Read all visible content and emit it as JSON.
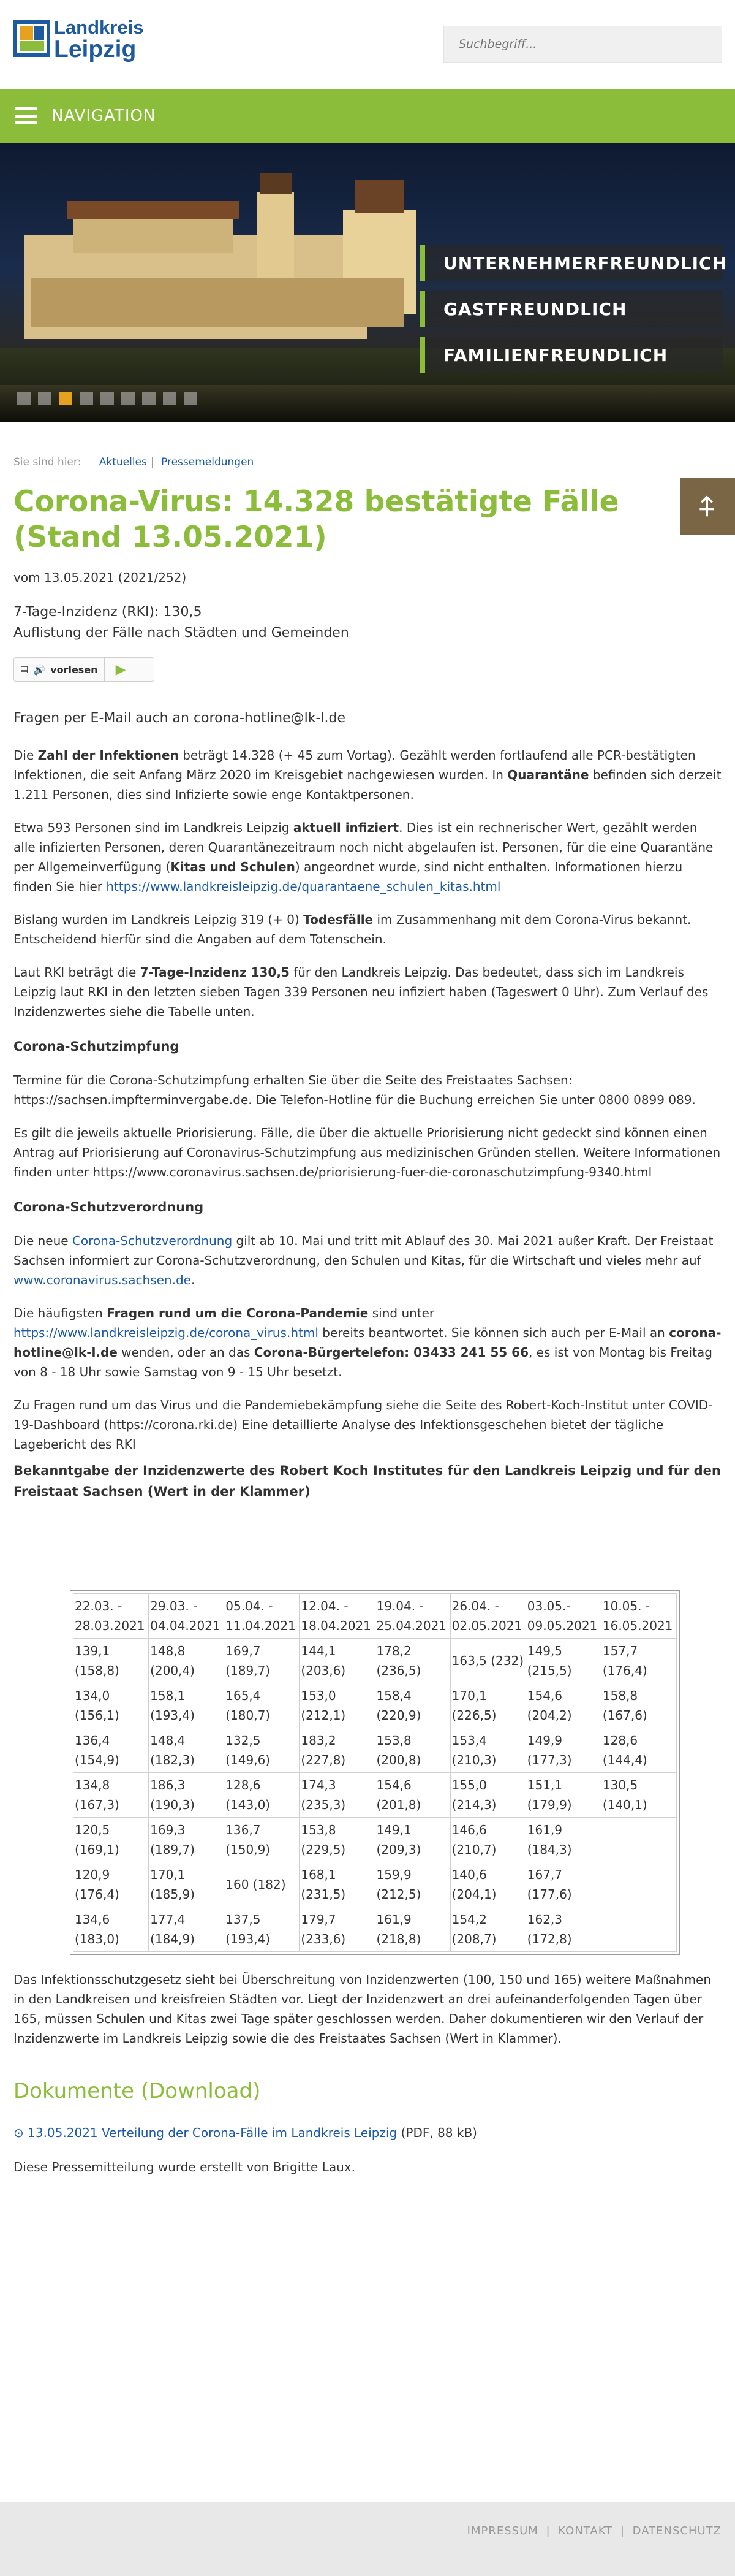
{
  "header": {
    "logo_line1": "Landkreis",
    "logo_line2": "Leipzig",
    "search_placeholder": "Suchbegriff...",
    "brand_colors": {
      "green": "#8bbd3b",
      "blue": "#1e5aa0",
      "orange": "#e6a21f"
    }
  },
  "nav": {
    "label": "NAVIGATION",
    "icon": "menu-icon"
  },
  "hero": {
    "claims": [
      "UNTERNEHMERFREUNDLICH",
      "GASTFREUNDLICH",
      "FAMILIENFREUNDLICH"
    ],
    "slide_count": 9,
    "active_slide": 2
  },
  "breadcrumb": {
    "label": "Sie sind hier:",
    "items": [
      "Aktuelles",
      "Pressemeldungen"
    ]
  },
  "article": {
    "title": "Corona-Virus: 14.328 bestätigte Fälle (Stand 13.05.2021)",
    "date": "vom 13.05.2021 (2021/252)",
    "incidence_line": "7-Tage-Inzidenz (RKI): 130,5",
    "subtitle": "Auflistung der Fälle nach Städten und Gemeinden",
    "reader_label": "vorlesen",
    "email_line": "Fragen per E-Mail auch an corona-hotline@lk-l.de",
    "p1_a": "Die ",
    "p1_b": "Zahl der Infektionen",
    "p1_c": " beträgt 14.328 (+ 45 zum Vortag). Gezählt werden fortlaufend alle PCR-bestätigten Infektionen, die seit Anfang März 2020 im Kreisgebiet nachgewiesen wurden. In ",
    "p1_d": "Quarantäne",
    "p1_e": " befinden sich derzeit 1.211 Personen, dies sind Infizierte sowie enge Kontaktpersonen.",
    "p2_a": "Etwa 593 Personen sind im Landkreis Leipzig ",
    "p2_b": "aktuell infiziert",
    "p2_c": ". Dies ist ein rechnerischer Wert, gezählt werden alle infizierten Personen, deren Quarantänezeitraum noch nicht abgelaufen ist. Personen, für die eine Quarantäne per Allgemeinverfügung (",
    "p2_d": "Kitas und Schulen",
    "p2_e": ") angeordnet wurde, sind nicht enthalten. Informationen hierzu finden Sie hier ",
    "p2_link": "https://www.landkreisleipzig.de/quarantaene_schulen_kitas.html",
    "p3_a": "Bislang wurden im Landkreis Leipzig 319 (+ 0) ",
    "p3_b": "Todesfälle",
    "p3_c": " im Zusammenhang mit dem Corona-Virus bekannt. Entscheidend hierfür sind die Angaben auf dem Totenschein.",
    "p4_a": "Laut RKI beträgt die ",
    "p4_b": "7-Tage-Inzidenz 130,5",
    "p4_c": " für den Landkreis Leipzig. Das bedeutet, dass sich im Landkreis Leipzig laut RKI in den letzten sieben Tagen 339 Personen neu infiziert haben (Tageswert 0 Uhr). Zum Verlauf des Inzidenzwertes siehe die Tabelle unten.",
    "h_impfung": "Corona-Schutzimpfung",
    "p5": "Termine für die Corona-Schutzimpfung erhalten Sie über die Seite des Freistaates Sachsen: https://sachsen.impfterminvergabe.de. Die Telefon-Hotline für die Buchung erreichen Sie unter 0800 0899 089.",
    "p6": "Es gilt die jeweils aktuelle Priorisierung. Fälle, die über die aktuelle Priorisierung nicht gedeckt sind können einen Antrag auf Priorisierung auf Coronavirus-Schutzimpfung aus medizinischen Gründen stellen. Weitere Informationen finden unter https://www.coronavirus.sachsen.de/priorisierung-fuer-die-coronaschutzimpfung-9340.html",
    "h_verordnung": "Corona-Schutzverordnung",
    "p7_a": "Die neue ",
    "p7_link": "Corona-Schutzverordnung",
    "p7_b": " gilt ab 10. Mai und tritt mit Ablauf des 30. Mai 2021 außer Kraft. Der Freistaat Sachsen informiert zur Corona-Schutzverordnung, den Schulen und Kitas, für die Wirtschaft und vieles mehr auf ",
    "p7_link2": "www.coronavirus.sachsen.de",
    "p7_c": ".",
    "p8_a": "Die häufigsten ",
    "p8_b": "Fragen rund um die Corona-Pandemie",
    "p8_c": " sind unter ",
    "p8_link": "https://www.landkreisleipzig.de/corona_virus.html",
    "p8_d": " bereits beantwortet. Sie können sich auch per E-Mail an ",
    "p8_e": "corona-hotline@lk-l.de",
    "p8_f": " wenden, oder an das ",
    "p8_g": "Corona-Bürgertelefon: 03433 241 55 66",
    "p8_h": ", es ist von Montag bis Freitag von 8 - 18 Uhr sowie Samstag von 9 - 15 Uhr besetzt.",
    "p9": "Zu Fragen rund um das Virus und die Pandemiebekämpfung siehe die Seite des Robert-Koch-Institut unter COVID-19-Dashboard (https://corona.rki.de)  Eine detaillierte Analyse des Infektionsgeschehen bietet der tägliche Lagebericht des RKI",
    "table_heading": "Bekanntgabe der Inzidenzwerte des Robert Koch Institutes für den Landkreis Leipzig und für den Freistaat Sachsen (Wert in der Klammer)",
    "table": {
      "header": [
        "22.03. - 28.03.2021",
        "29.03. - 04.04.2021",
        "05.04. - 11.04.2021",
        "12.04. - 18.04.2021",
        "19.04. - 25.04.2021",
        "26.04. - 02.05.2021",
        "03.05.- 09.05.2021",
        "10.05. - 16.05.2021"
      ],
      "rows": [
        [
          "139,1 (158,8)",
          "148,8 (200,4)",
          "169,7 (189,7)",
          "144,1 (203,6)",
          "178,2 (236,5)",
          "163,5 (232)",
          "149,5 (215,5)",
          "157,7 (176,4)"
        ],
        [
          "134,0 (156,1)",
          "158,1 (193,4)",
          "165,4 (180,7)",
          "153,0 (212,1)",
          "158,4 (220,9)",
          "170,1 (226,5)",
          "154,6 (204,2)",
          "158,8 (167,6)"
        ],
        [
          "136,4 (154,9)",
          "148,4 (182,3)",
          "132,5 (149,6)",
          "183,2 (227,8)",
          "153,8 (200,8)",
          "153,4 (210,3)",
          "149,9 (177,3)",
          "128,6 (144,4)"
        ],
        [
          "134,8 (167,3)",
          "186,3 (190,3)",
          "128,6 (143,0)",
          "174,3 (235,3)",
          "154,6 (201,8)",
          "155,0 (214,3)",
          "151,1 (179,9)",
          "130,5 (140,1)"
        ],
        [
          "120,5 (169,1)",
          "169,3 (189,7)",
          "136,7 (150,9)",
          "153,8 (229,5)",
          "149,1 (209,3)",
          "146,6 (210,7)",
          "161,9 (184,3)",
          ""
        ],
        [
          "120,9 (176,4)",
          "170,1 (185,9)",
          "160 (182)",
          "168,1 (231,5)",
          "159,9 (212,5)",
          "140,6 (204,1)",
          "167,7 (177,6)",
          ""
        ],
        [
          "134,6 (183,0)",
          "177,4 (184,9)",
          "137,5 (193,4)",
          "179,7 (233,6)",
          "161,9 (218,8)",
          "154,2 (208,7)",
          "162,3 (172,8)",
          ""
        ]
      ]
    },
    "p_after": "Das Infektionsschutzgesetz sieht bei Überschreitung von Inzidenzwerten (100, 150 und 165) weitere Maßnahmen in den Landkreisen und kreisfreien Städten vor. Liegt der Inzidenzwert an drei aufeinanderfolgenden Tagen über 165, müssen Schulen und Kitas zwei Tage später geschlossen werden. Daher dokumentieren wir den Verlauf der Inzidenzwerte im Landkreis Leipzig sowie die des Freistaates Sachsen (Wert in Klammer).",
    "downloads_heading": "Dokumente (Download)",
    "download_link": "13.05.2021 Verteilung der Corona-Fälle im Landkreis Leipzig",
    "download_meta": " (PDF, 88 kB)",
    "author": "Diese Pressemitteilung wurde erstellt von Brigitte Laux."
  },
  "footer": {
    "links": [
      "IMPRESSUM",
      "KONTAKT",
      "DATENSCHUTZ"
    ],
    "separator": "|"
  }
}
